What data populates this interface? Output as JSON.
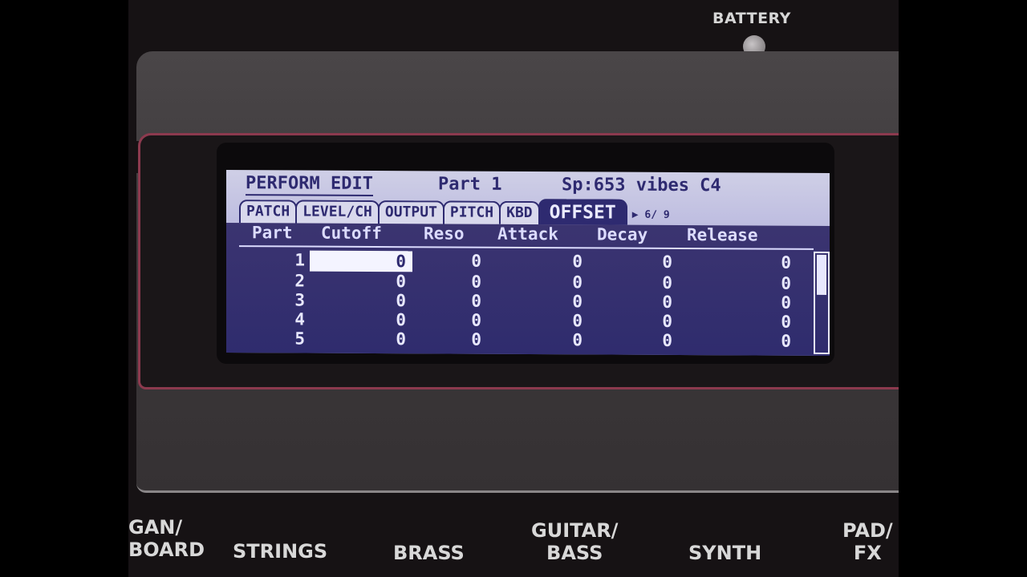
{
  "device": {
    "battery_label": "BATTERY"
  },
  "lcd": {
    "header": {
      "title": "PERFORM EDIT",
      "part": "Part 1",
      "patch": "Sp:653 vibes C4"
    },
    "tabs": [
      {
        "label": "PATCH",
        "active": false
      },
      {
        "label": "LEVEL/CH",
        "active": false
      },
      {
        "label": "OUTPUT",
        "active": false
      },
      {
        "label": "PITCH",
        "active": false
      },
      {
        "label": "KBD",
        "active": false
      },
      {
        "label": "OFFSET",
        "active": true
      }
    ],
    "tab_page": "▶ 6/ 9",
    "columns": [
      "Part",
      "Cutoff",
      "Reso",
      "Attack",
      "Decay",
      "Release"
    ],
    "rows": [
      {
        "part": "1",
        "cutoff": "0",
        "reso": "0",
        "attack": "0",
        "decay": "0",
        "release": "0"
      },
      {
        "part": "2",
        "cutoff": "0",
        "reso": "0",
        "attack": "0",
        "decay": "0",
        "release": "0"
      },
      {
        "part": "3",
        "cutoff": "0",
        "reso": "0",
        "attack": "0",
        "decay": "0",
        "release": "0"
      },
      {
        "part": "4",
        "cutoff": "0",
        "reso": "0",
        "attack": "0",
        "decay": "0",
        "release": "0"
      },
      {
        "part": "5",
        "cutoff": "0",
        "reso": "0",
        "attack": "0",
        "decay": "0",
        "release": "0"
      }
    ]
  },
  "buttons": {
    "organ": "GAN/\nBOARD",
    "strings": "STRINGS",
    "brass": "BRASS",
    "guitar_bass": "GUITAR/\nBASS",
    "synth": "SYNTH",
    "pad_fx": "PAD/\nFX"
  }
}
